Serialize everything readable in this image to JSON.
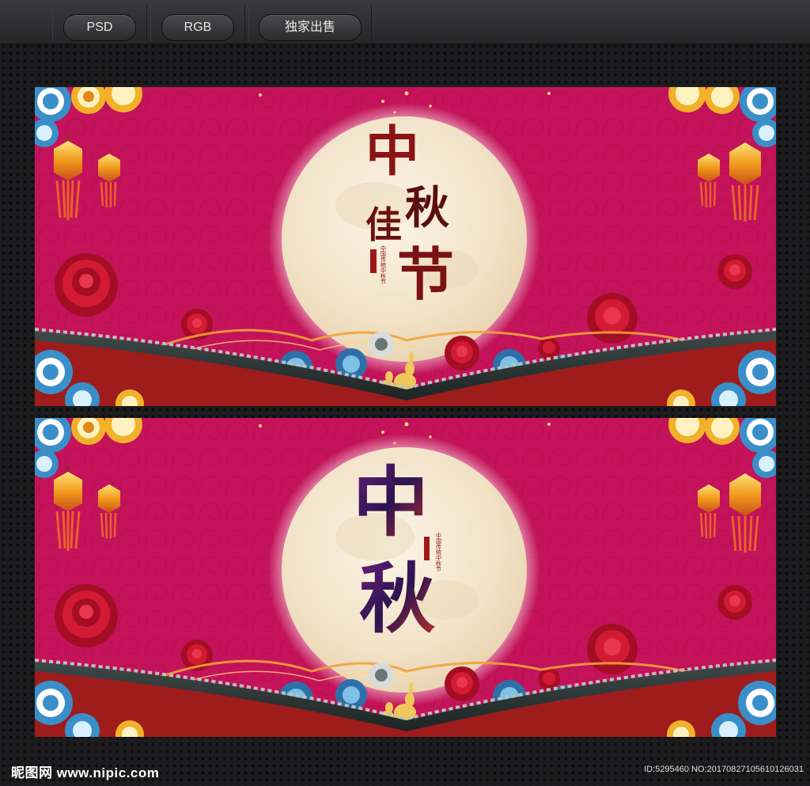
{
  "toolbar": {
    "tab_psd": "PSD",
    "tab_rgb": "RGB",
    "tab_exclusive": "独家出售"
  },
  "banner_1": {
    "title_chars": [
      "中",
      "秋",
      "佳",
      "节"
    ],
    "seal_text": "中国传统中秋节"
  },
  "banner_2": {
    "title_chars": [
      "中",
      "秋"
    ],
    "seal_text": "中国传统中秋节"
  },
  "footer": {
    "watermark": "昵图网 www.nipic.com",
    "id_text": "ID:5295460 NO:20170827105610126031"
  },
  "colors": {
    "banner_background": "#c4135a",
    "moon": "#f7ecd8",
    "title_red": "#8a1414",
    "title_purple": "#4b1a5a",
    "lantern": "#f2b12a",
    "peony": "#c8102e",
    "cloud_blue": "#3a8fc9"
  }
}
